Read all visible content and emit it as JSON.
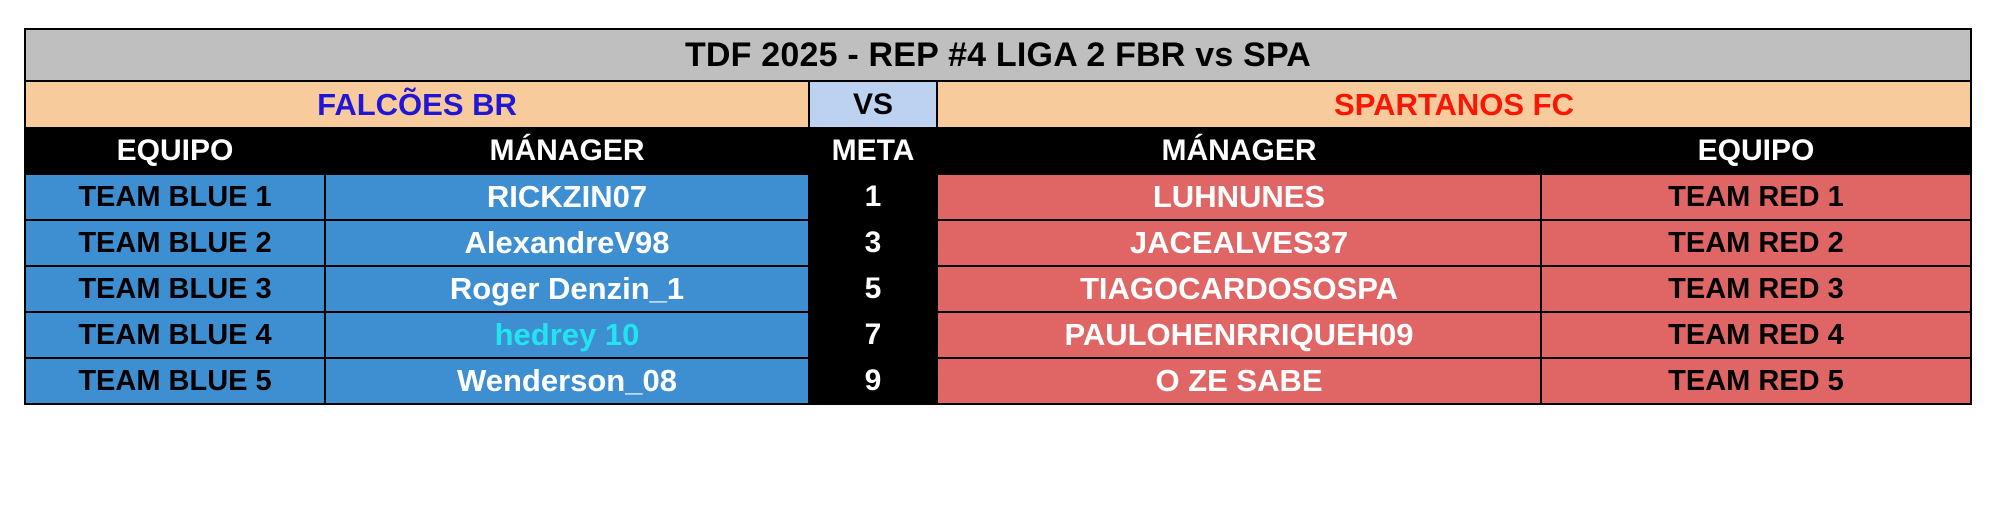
{
  "title": {
    "text": "TDF 2025 - REP #4 LIGA 2 FBR vs SPA"
  },
  "teams": {
    "left_name": "FALCÕES BR",
    "vs_label": "VS",
    "right_name": "SPARTANOS FC"
  },
  "columns": {
    "equipo_left": "EQUIPO",
    "manager_left": "MÁNAGER",
    "meta": "META",
    "manager_right": "MÁNAGER",
    "equipo_right": "EQUIPO"
  },
  "rows": [
    {
      "equipo_left": "TEAM BLUE 1",
      "manager_left": "RICKZIN07",
      "meta": "1",
      "manager_right": "LUHNUNES",
      "equipo_right": "TEAM RED 1",
      "manager_left_accent": "none"
    },
    {
      "equipo_left": "TEAM BLUE 2",
      "manager_left": "AlexandreV98",
      "meta": "3",
      "manager_right": "JACEALVES37",
      "equipo_right": "TEAM RED 2",
      "manager_left_accent": "none"
    },
    {
      "equipo_left": "TEAM BLUE 3",
      "manager_left": "Roger Denzin_1",
      "meta": "5",
      "manager_right": "TIAGOCARDOSOSPA",
      "equipo_right": "TEAM RED 3",
      "manager_left_accent": "none"
    },
    {
      "equipo_left": "TEAM BLUE 4",
      "manager_left": "hedrey 10",
      "meta": "7",
      "manager_right": "PAULOHENRRIQUEH09",
      "equipo_right": "TEAM RED 4",
      "manager_left_accent": "cyan"
    },
    {
      "equipo_left": "TEAM BLUE 5",
      "manager_left": "Wenderson_08",
      "meta": "9",
      "manager_right": "O ZE SABE",
      "equipo_right": "TEAM RED 5",
      "manager_left_accent": "none"
    }
  ],
  "colors": {
    "title_bg": "#bfbfbf",
    "team_bg": "#f8cb9c",
    "vs_bg": "#bdd2f0",
    "left_team_text": "#2116d6",
    "right_team_text": "#fa1505",
    "blue_row": "#3d8fd1",
    "red_row": "#e06666",
    "meta_bg": "#000000",
    "accent_cyan": "#22e3f0"
  }
}
